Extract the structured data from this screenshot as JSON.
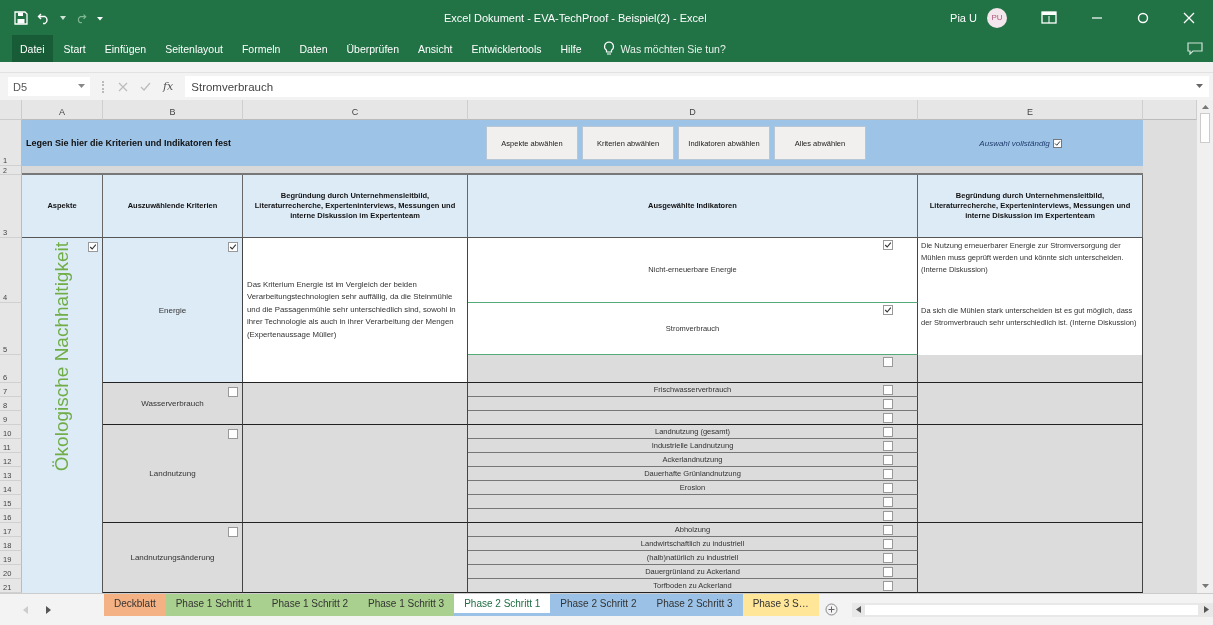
{
  "window": {
    "title": "Excel Dokument - EVA-TechProof - Beispiel(2) - Excel",
    "user": "Pia U",
    "initials": "PU"
  },
  "ribbon": {
    "tabs": [
      {
        "label": "Datei",
        "kind": "file"
      },
      {
        "label": "Start",
        "kind": "tab"
      },
      {
        "label": "Einfügen",
        "kind": "tab"
      },
      {
        "label": "Seitenlayout",
        "kind": "tab"
      },
      {
        "label": "Formeln",
        "kind": "tab"
      },
      {
        "label": "Daten",
        "kind": "tab"
      },
      {
        "label": "Überprüfen",
        "kind": "tab"
      },
      {
        "label": "Ansicht",
        "kind": "tab"
      },
      {
        "label": "Entwicklertools",
        "kind": "tab"
      },
      {
        "label": "Hilfe",
        "kind": "tab"
      }
    ],
    "tell_me": "Was möchten Sie tun?"
  },
  "formula_bar": {
    "name_box": "D5",
    "function_label": "fx",
    "content": "Stromverbrauch"
  },
  "column_headers": [
    "A",
    "B",
    "C",
    "D",
    "E"
  ],
  "row_numbers": [
    "1",
    "2",
    "3",
    "4",
    "5",
    "6",
    "7",
    "8",
    "9",
    "10",
    "11",
    "12",
    "13",
    "14",
    "15",
    "16",
    "17",
    "18",
    "19",
    "20",
    "21"
  ],
  "sheet": {
    "title": "Legen Sie hier die Kriterien und Indikatoren fest",
    "buttons": [
      "Aspekte abwählen",
      "Kriterien abwählen",
      "Indikatoren abwählen",
      "Alles abwählen"
    ],
    "completeness": {
      "label": "Auswahl vollständig",
      "checked": true
    },
    "headers": [
      "Aspekte",
      "Auszuwählende Kriterien",
      "Begründung durch Unternehmensleitbild, Literaturrecherche, Experteninterviews, Messungen und interne Diskussion im Expertenteam",
      "Ausgewählte Indikatoren",
      "Begründung durch Unternehmensleitbild, Literaturrecherche, Experteninterviews, Messungen und interne Diskussion im Expertenteam"
    ],
    "aspect": {
      "label": "Ökologische Nachhaltigkeit",
      "checked": true
    },
    "criteria": [
      {
        "name": "Energie",
        "checked": true,
        "selected": true,
        "reason": "Das Kriterium Energie ist im Vergleich der beiden Verarbeitungstechnologien sehr auffällig, da die Steinmühle und die Passagenmühle sehr unterschiedlich sind, sowohl in ihrer Technologie als auch in ihrer Verarbeitung der Mengen (Expertenaussage Müller)",
        "indicators": [
          {
            "name": "Nicht-erneuerbare Energie",
            "checked": true,
            "selected": true,
            "reason": "Die Nutzung erneuerbarer Energie zur Stromversorgung der Mühlen muss geprüft werden und könnte sich unterscheiden. (Interne Diskussion)"
          },
          {
            "name": "Stromverbrauch",
            "checked": true,
            "selected": true,
            "reason": "Da sich die Mühlen stark unterscheiden ist es gut möglich, dass der Stromverbrauch sehr unterschiedlich ist. (Interne Diskussion)"
          },
          {
            "checked": false,
            "selected": false
          }
        ]
      },
      {
        "name": "Wasserverbrauch",
        "checked": false,
        "selected": false,
        "indicators": [
          {
            "name": "Frischwasserverbrauch",
            "checked": false,
            "selected": false
          },
          {
            "checked": false,
            "selected": false
          },
          {
            "checked": false,
            "selected": false
          }
        ]
      },
      {
        "name": "Landnutzung",
        "checked": false,
        "selected": false,
        "indicators": [
          {
            "name": "Landnutzung (gesamt)",
            "checked": false,
            "selected": false
          },
          {
            "name": "Industrielle Landnutzung",
            "checked": false,
            "selected": false
          },
          {
            "name": "Ackerlandnutzung",
            "checked": false,
            "selected": false
          },
          {
            "name": "Dauerhafte Grünlandnutzung",
            "checked": false,
            "selected": false
          },
          {
            "name": "Erosion",
            "checked": false,
            "selected": false
          },
          {
            "checked": false,
            "selected": false
          },
          {
            "checked": false,
            "selected": false
          }
        ]
      },
      {
        "name": "Landnutzungsänderung",
        "checked": false,
        "selected": false,
        "indicators": [
          {
            "name": "Abholzung",
            "checked": false,
            "selected": false
          },
          {
            "name": "Landwirtschaftlich zu industriell",
            "checked": false,
            "selected": false
          },
          {
            "name": "(halb)natürlich zu industriell",
            "checked": false,
            "selected": false
          },
          {
            "name": "Dauergrünland zu Ackerland",
            "checked": false,
            "selected": false
          },
          {
            "name": "Torfboden zu Ackerland",
            "checked": false,
            "selected": false
          }
        ]
      }
    ]
  },
  "sheet_tabs": [
    {
      "label": "Deckblatt",
      "color": "#f4b183",
      "selected": false
    },
    {
      "label": "Phase 1 Schritt 1",
      "color": "#a9d08e",
      "selected": false
    },
    {
      "label": "Phase 1 Schritt 2",
      "color": "#a9d08e",
      "selected": false
    },
    {
      "label": "Phase 1 Schritt 3",
      "color": "#a9d08e",
      "selected": false
    },
    {
      "label": "Phase 2 Schritt 1",
      "color": "#9bc2e6",
      "selected": true
    },
    {
      "label": "Phase 2 Schritt 2",
      "color": "#9bc2e6",
      "selected": false
    },
    {
      "label": "Phase 2 Schritt 3",
      "color": "#9bc2e6",
      "selected": false
    },
    {
      "label": "Phase 3 S…",
      "color": "#ffe699",
      "selected": false
    }
  ]
}
